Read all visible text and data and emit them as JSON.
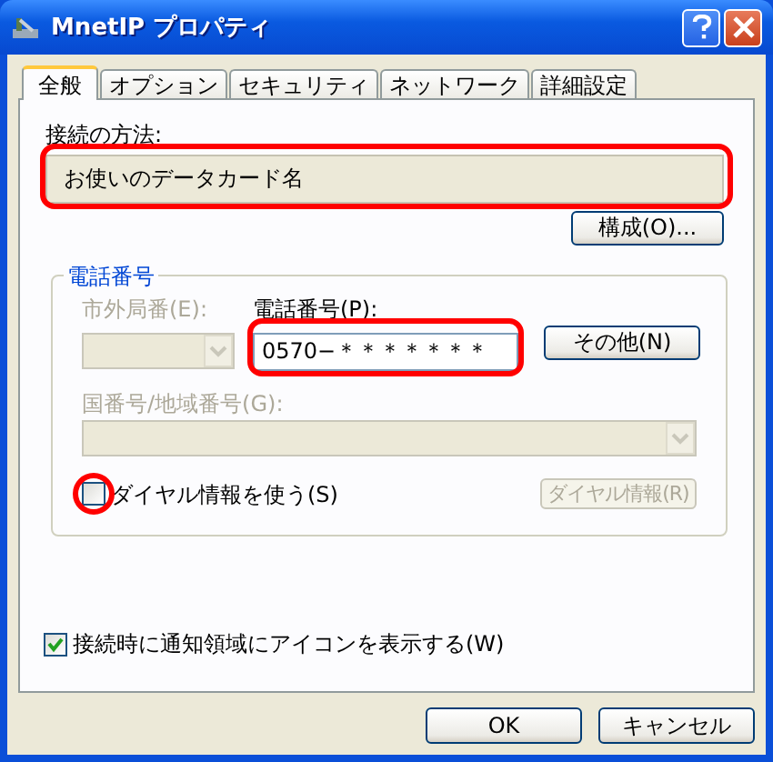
{
  "window": {
    "title": "MnetIP プロパティ"
  },
  "tabs": [
    {
      "label": "全般",
      "selected": true
    },
    {
      "label": "オプション",
      "selected": false
    },
    {
      "label": "セキュリティ",
      "selected": false
    },
    {
      "label": "ネットワーク",
      "selected": false
    },
    {
      "label": "詳細設定",
      "selected": false
    }
  ],
  "connection": {
    "label": "接続の方法:",
    "value": "お使いのデータカード名",
    "highlighted": true
  },
  "configure_button": "構成(O)...",
  "phone_group": {
    "legend": "電話番号",
    "area_code": {
      "label": "市外局番(E):",
      "disabled": true
    },
    "phone_number": {
      "label": "電話番号(P):",
      "value": "0570−＊＊＊＊＊＊＊",
      "highlighted": true
    },
    "other_button": "その他(N)",
    "country_code": {
      "label": "国番号/地域番号(G):",
      "disabled": true
    },
    "dialing_rules": {
      "label": "ダイヤル情報を使う(S)",
      "checked": false,
      "highlighted": true
    },
    "dialing_button": {
      "label": "ダイヤル情報(R)",
      "disabled": true
    }
  },
  "notify_checkbox": {
    "label": "接続時に通知領域にアイコンを表示する(W)",
    "checked": true
  },
  "buttons": [
    "OK",
    "キャンセル"
  ]
}
